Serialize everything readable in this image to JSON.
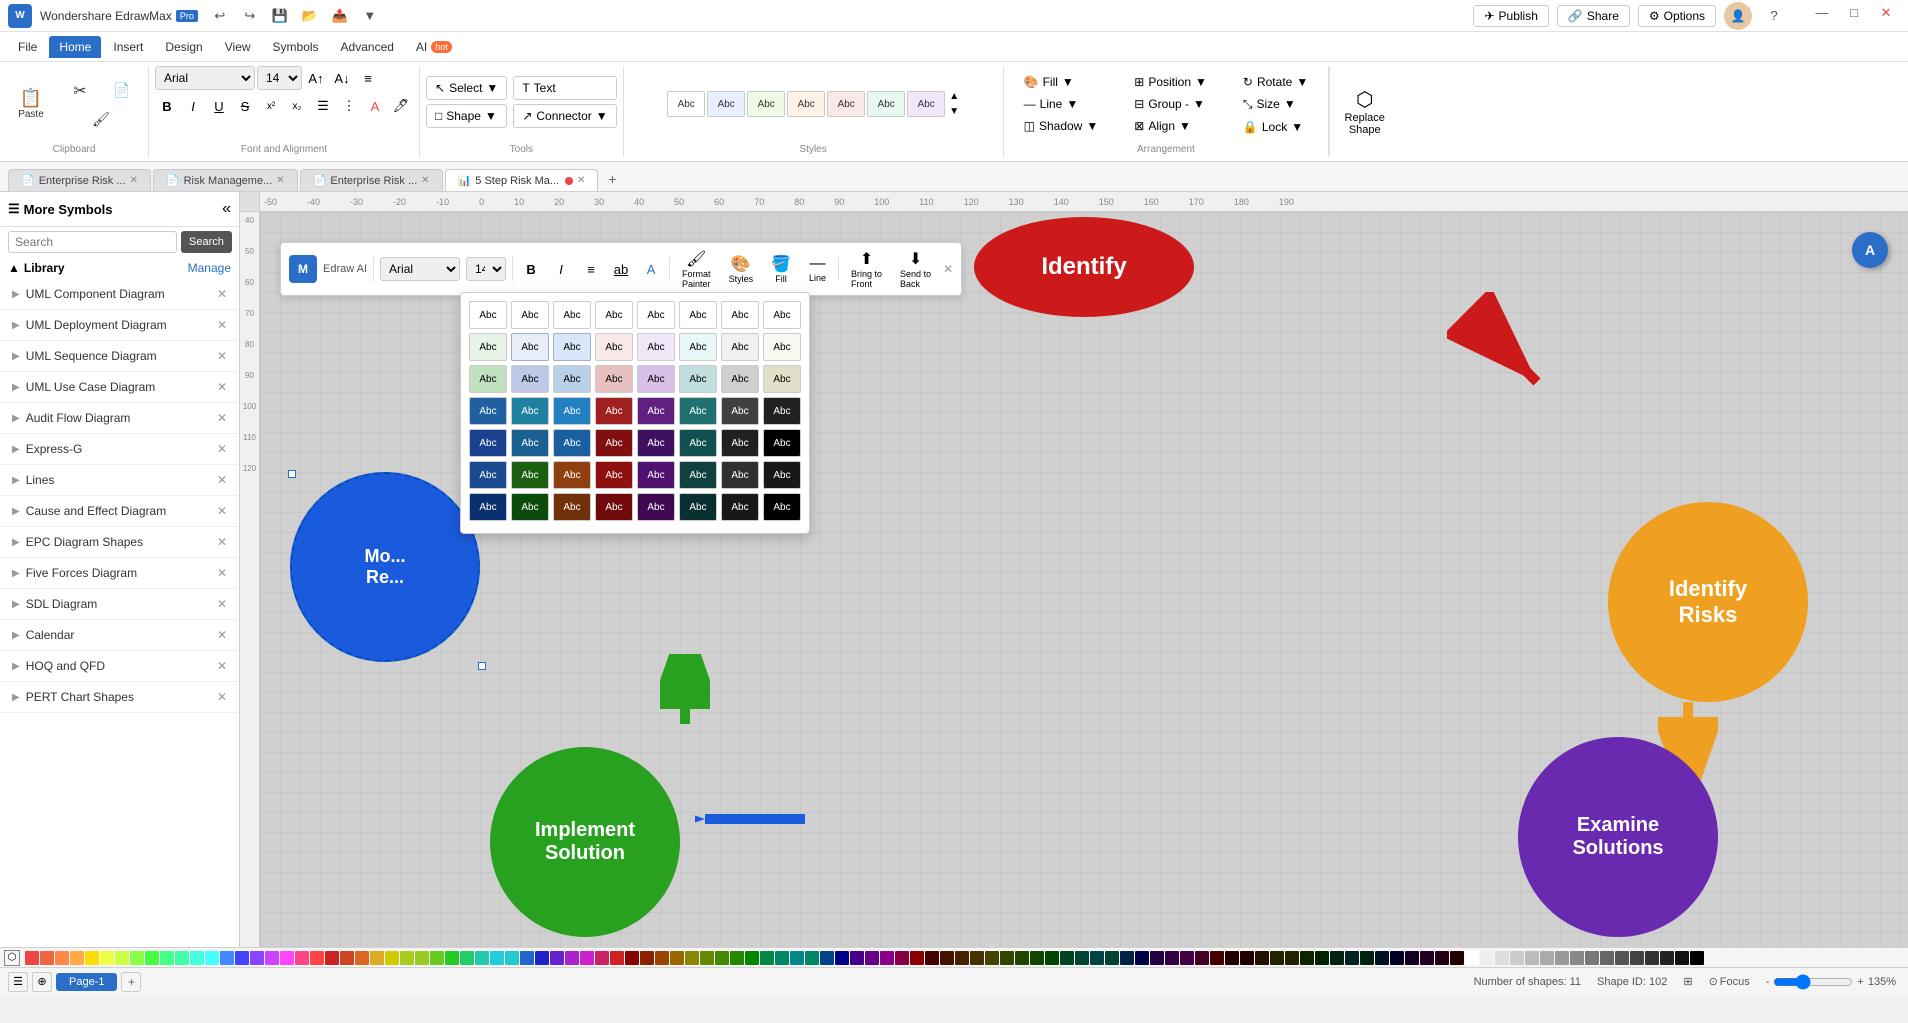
{
  "app": {
    "name": "Wondershare EdrawMax",
    "version": "Pro",
    "title": "Wondershare EdrawMax Pro"
  },
  "titlebar": {
    "undo": "↩",
    "redo": "↪",
    "save": "💾",
    "open": "📁",
    "export": "📤",
    "minimize": "—",
    "maximize": "□",
    "close": "✕",
    "publish": "Publish",
    "share": "Share",
    "options": "Options"
  },
  "menu": {
    "items": [
      "File",
      "Home",
      "Insert",
      "Design",
      "View",
      "Symbols",
      "Advanced",
      "AI"
    ]
  },
  "ribbon": {
    "clipboard": {
      "label": "Clipboard",
      "cut": "✂",
      "copy": "📋",
      "paste": "📌",
      "format_painter": "🖌"
    },
    "font": {
      "label": "Font and Alignment",
      "family": "Arial",
      "size": "14",
      "bold": "B",
      "italic": "I",
      "underline": "U",
      "strikethrough": "S",
      "superscript": "x²",
      "subscript": "x₂"
    },
    "tools": {
      "label": "Tools",
      "select": "Select",
      "shape": "Shape",
      "text": "Text",
      "connector": "Connector"
    },
    "styles": {
      "label": "Styles",
      "swatches": [
        "Abc",
        "Abc",
        "Abc",
        "Abc",
        "Abc",
        "Abc",
        "Abc"
      ]
    },
    "arrangement": {
      "label": "Arrangement",
      "fill": "Fill",
      "line": "Line",
      "shadow": "Shadow",
      "position": "Position",
      "group": "Group",
      "align": "Align",
      "rotate": "Rotate",
      "size": "Size",
      "lock": "Lock",
      "replace_shape": "Replace Shape",
      "replace": "Replace",
      "group_minus": "Group -",
      "bring_to_front": "Bring to Front",
      "send_to_back": "Send to Back"
    }
  },
  "tabs": [
    {
      "label": "Enterprise Risk ...",
      "active": false,
      "closable": true
    },
    {
      "label": "Risk Manageme...",
      "active": false,
      "closable": true
    },
    {
      "label": "Enterprise Risk ...",
      "active": false,
      "closable": true
    },
    {
      "label": "5 Step Risk Ma...",
      "active": true,
      "closable": true
    }
  ],
  "sidebar": {
    "title": "More Symbols",
    "search_placeholder": "Search",
    "search_btn": "Search",
    "library": "Library",
    "manage": "Manage",
    "items": [
      {
        "label": "UML Component Diagram",
        "closable": true
      },
      {
        "label": "UML Deployment Diagram",
        "closable": true
      },
      {
        "label": "UML Sequence Diagram",
        "closable": true
      },
      {
        "label": "UML Use Case Diagram",
        "closable": true
      },
      {
        "label": "Audit Flow Diagram",
        "closable": true
      },
      {
        "label": "Express-G",
        "closable": true
      },
      {
        "label": "Lines",
        "closable": true
      },
      {
        "label": "Cause and Effect Diagram",
        "closable": true
      },
      {
        "label": "EPC Diagram Shapes",
        "closable": true
      },
      {
        "label": "Five Forces Diagram",
        "closable": true
      },
      {
        "label": "SDL Diagram",
        "closable": true
      },
      {
        "label": "Calendar",
        "closable": true
      },
      {
        "label": "HOQ and QFD",
        "closable": true
      },
      {
        "label": "PERT Chart Shapes",
        "closable": true
      }
    ]
  },
  "floating_toolbar": {
    "logo": "M",
    "app_name": "Edraw AI",
    "font_family": "Arial",
    "font_size": "14",
    "bold": "B",
    "italic": "I",
    "align": "≡",
    "underline": "ab",
    "text_color": "A",
    "format_painter": "Format Painter",
    "styles": "Styles",
    "fill": "Fill",
    "line": "Line",
    "bring_to_front": "Bring to Front",
    "send_to_back": "Send to Back"
  },
  "style_grid": {
    "rows": [
      [
        "#fff",
        "#fff",
        "#fff",
        "#fff",
        "#fff",
        "#fff",
        "#fff",
        "#fff"
      ],
      [
        "#e8f4e8",
        "#e8eef8",
        "#f8f0e8",
        "#f8e8e8",
        "#f0e8f8",
        "#e8f8f8",
        "#f0f0f0",
        "#f8f8f8"
      ],
      [
        "#c0d8c0",
        "#c0d0e8",
        "#e8d8c0",
        "#e8c0c0",
        "#d8c0e8",
        "#c0e8e8",
        "#d0d0d0",
        "#e0e0e0"
      ],
      [
        "#2060a0",
        "#208020",
        "#a06020",
        "#a02020",
        "#602080",
        "#207070",
        "#404040",
        "#202020"
      ],
      [
        "#1040808",
        "#106010",
        "#804010",
        "#801010",
        "#401060",
        "#105050",
        "#202020",
        "#000000"
      ],
      [
        "#1a4a90",
        "#1a6010",
        "#904010",
        "#901010",
        "#501070",
        "#104040",
        "#303030",
        "#181818"
      ],
      [
        "#0a3070",
        "#0a4a0a",
        "#703008",
        "#700a0a",
        "#400850",
        "#083030",
        "#181818",
        "#000000"
      ]
    ]
  },
  "diagram": {
    "shapes": [
      {
        "type": "circle",
        "label": "Identify\nRisks",
        "color": "#f0a020",
        "text_color": "white"
      },
      {
        "type": "circle",
        "label": "Examine\nSolutions",
        "color": "#6a2aaf",
        "text_color": "white"
      },
      {
        "type": "circle",
        "label": "Implement\nSolution",
        "color": "#28a020",
        "text_color": "white"
      },
      {
        "type": "circle",
        "label": "Mo...\nRe...",
        "color": "#1a5adc",
        "text_color": "white"
      },
      {
        "type": "oval",
        "label": "Identify",
        "color": "#cc1a1a",
        "text_color": "white"
      }
    ]
  },
  "status_bar": {
    "shapes_count": "Number of shapes: 11",
    "shape_id": "Shape ID: 102",
    "focus": "Focus",
    "zoom": "135%"
  },
  "page_tabs": [
    {
      "label": "Page-1",
      "active": true
    }
  ],
  "colors": {
    "accent": "#2a6ec7",
    "danger": "#cc1a1a",
    "orange": "#f0a020",
    "green": "#28a020",
    "purple": "#6a2aaf",
    "blue": "#1a5adc"
  }
}
